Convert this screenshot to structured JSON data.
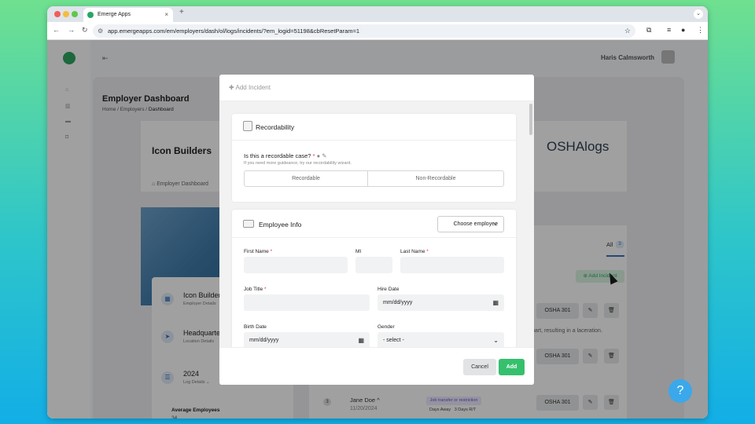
{
  "browser": {
    "tab_title": "Emerge Apps",
    "tab_close": "×",
    "new_tab": "+",
    "url": "app.emergeapps.com/em/employers/dash/ol/logs/incidents/?em_logid=51198&cbResetParam=1"
  },
  "header": {
    "user_name": "Haris Calmsworth"
  },
  "page": {
    "title": "Employer Dashboard",
    "breadcrumb": [
      "Home",
      "Employers",
      "Dashboard"
    ],
    "company": "Icon Builders",
    "brand_logo": "OSHAlogs",
    "tab_employer_dashboard": "Employer Dashboard"
  },
  "entities": [
    {
      "title": "Icon Builders",
      "sub": "Employer Details"
    },
    {
      "title": "Headquarters",
      "sub": "Location Details"
    },
    {
      "title": "2024",
      "sub": "Log Details"
    }
  ],
  "stats": {
    "avg_label": "Average Employees",
    "avg_value": "34"
  },
  "incidents_panel": {
    "all_label": "All",
    "all_count": "3",
    "add_incident": "Add Incident",
    "osha_label": "OSHA 301",
    "snippet": "part, resulting in a laceration.",
    "row_num": "3",
    "employee": "Jane Doe",
    "date": "11/20/2024",
    "type_badge": "Job transfer or restriction",
    "days_label": "Days Away",
    "days_value": "3 Days R/T"
  },
  "modal": {
    "title": "Add Incident",
    "recordability": {
      "heading": "Recordability",
      "question": "Is this a recordable case?",
      "hint": "If you need more guideance, try our recordability wizard.",
      "options": [
        "Recordable",
        "Non-Recordable"
      ]
    },
    "employee_info": {
      "heading": "Employee Info",
      "choose_label": "Choose employee",
      "fields": {
        "first_name": "First Name",
        "mi": "MI",
        "last_name": "Last Name",
        "job_title": "Job Title",
        "hire_date": "Hire Date",
        "hire_placeholder": "mm/dd/yyyy",
        "birth_date": "Birth Date",
        "birth_placeholder": "mm/dd/yyyy",
        "gender": "Gender",
        "gender_value": "- select -"
      }
    },
    "cancel_label": "Cancel",
    "add_label": "Add"
  },
  "help_label": "?",
  "colors": {
    "accent_green": "#36c06d",
    "link_blue": "#3a6fc0",
    "help_blue": "#3aa8ea"
  }
}
